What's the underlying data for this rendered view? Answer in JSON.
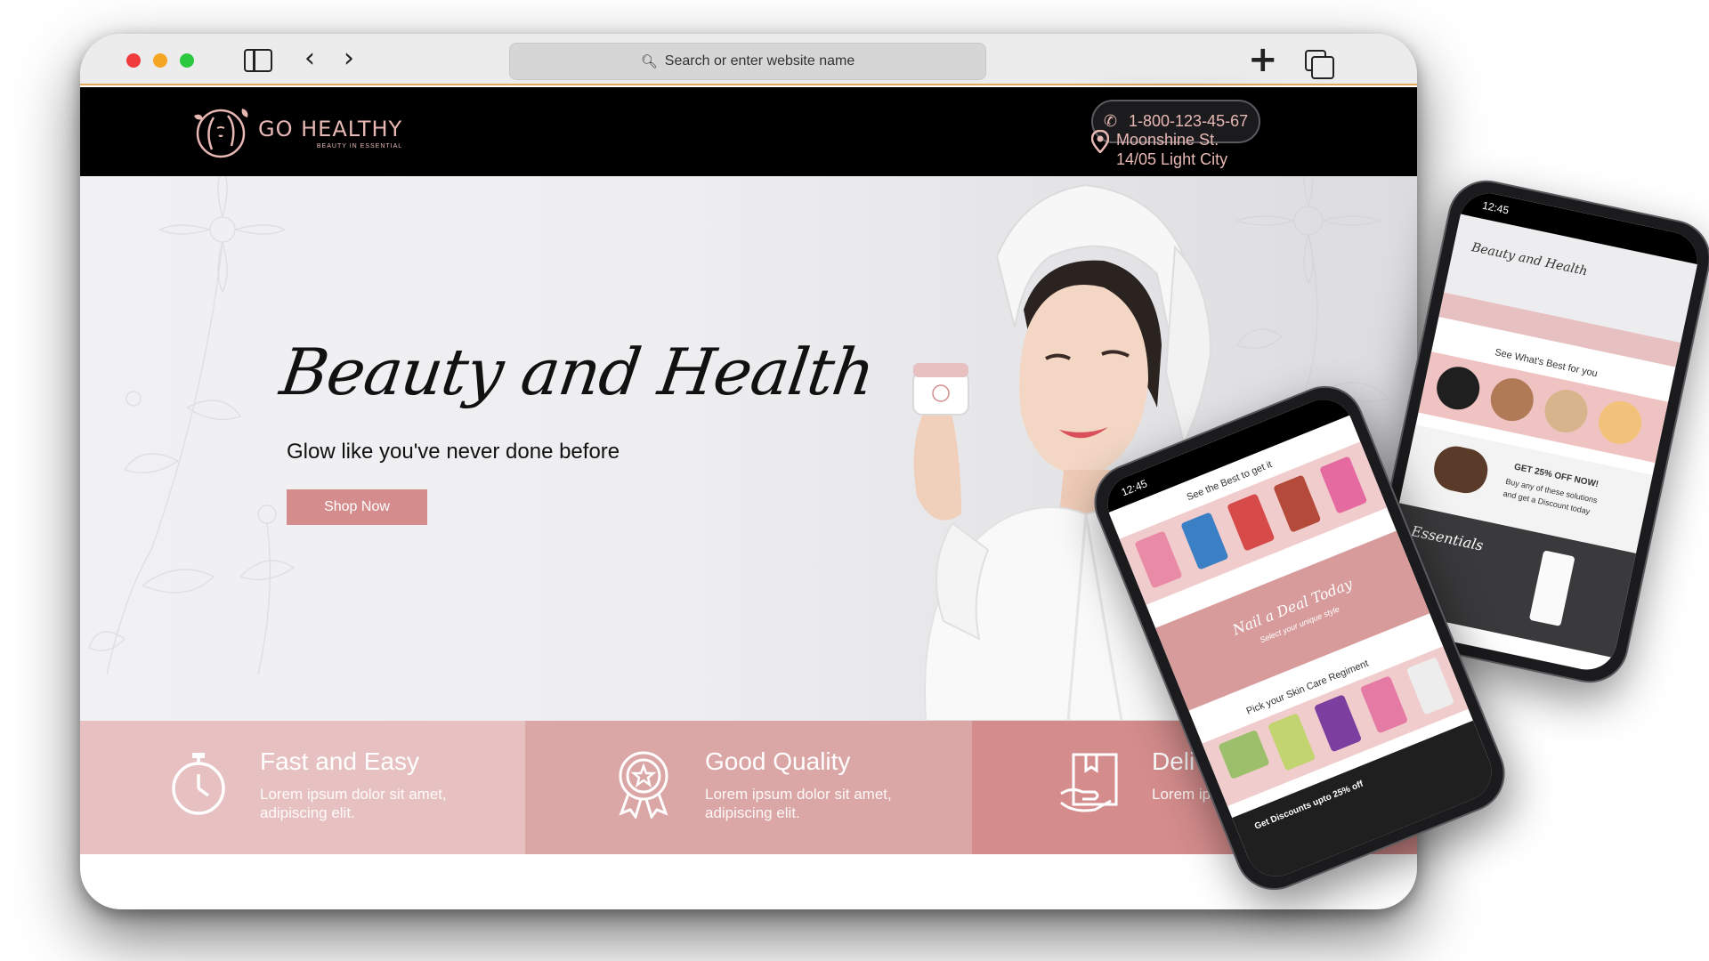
{
  "browser": {
    "address_placeholder": "Search or enter website name"
  },
  "site": {
    "logo_name": "GO HEALTHY",
    "logo_tagline": "BEAUTY IN ESSENTIAL",
    "phone": "1-800-123-45-67",
    "address_line1": "Moonshine St.",
    "address_line2": "14/05 Light City"
  },
  "hero": {
    "title": "Beauty and Health",
    "subtitle": "Glow like you've never done before",
    "cta": "Shop Now"
  },
  "features": [
    {
      "title": "Fast and Easy",
      "desc": "Lorem ipsum dolor sit amet, adipiscing elit.",
      "icon": "stopwatch-icon"
    },
    {
      "title": "Good Quality",
      "desc": "Lorem ipsum dolor sit amet, adipiscing elit.",
      "icon": "award-ribbon-icon"
    },
    {
      "title": "Deliver",
      "desc": "Lorem ipsum amet, adipisc",
      "icon": "delivery-box-icon"
    }
  ],
  "phone_back": {
    "time": "12:45",
    "hero_title": "Beauty and Health",
    "section_title": "See What's Best for you",
    "promo_line1": "GET 25% OFF NOW!",
    "promo_line2": "Buy any of these solutions",
    "promo_line3": "and get a Discount today",
    "essentials": "Essentials"
  },
  "phone_front": {
    "time": "12:45",
    "section1_title": "See the Best to get it",
    "deal_title": "Nail a Deal Today",
    "deal_sub": "Select your unique style",
    "section2_title": "Pick your Skin Care Regiment",
    "footer_text": "Get Discounts upto 25% off"
  },
  "colors": {
    "accent": "#d48c8c",
    "light_pink": "#e7c1c1",
    "mid_pink": "#dba6a6",
    "header_bg": "#000000",
    "logo_pink": "#e8b8b4"
  }
}
